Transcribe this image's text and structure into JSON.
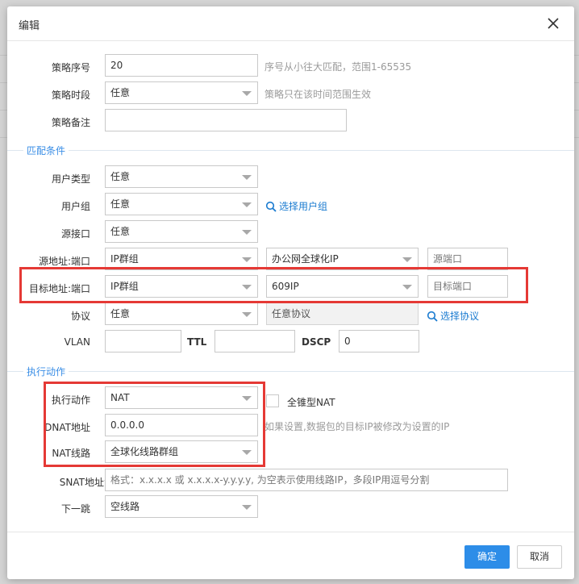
{
  "dialog": {
    "title": "编辑",
    "close_icon": "close-icon"
  },
  "policy": {
    "seq_label": "策略序号",
    "seq_value": "20",
    "seq_hint": "序号从小往大匹配，范围1-65535",
    "time_label": "策略时段",
    "time_value": "任意",
    "time_hint": "策略只在该时间范围生效",
    "note_label": "策略备注",
    "note_value": ""
  },
  "match": {
    "section_title": "匹配条件",
    "user_type_label": "用户类型",
    "user_type_value": "任意",
    "user_group_label": "用户组",
    "user_group_value": "任意",
    "select_user_group_link": "选择用户组",
    "src_iface_label": "源接口",
    "src_iface_value": "任意",
    "src_addr_label": "源地址:端口",
    "src_addr_type": "IP群组",
    "src_addr_group": "办公网全球化IP",
    "src_port_placeholder": "源端口",
    "dst_addr_label": "目标地址:端口",
    "dst_addr_type": "IP群组",
    "dst_addr_group": "609IP",
    "dst_port_placeholder": "目标端口",
    "protocol_label": "协议",
    "protocol_value": "任意",
    "protocol_detail": "任意协议",
    "select_protocol_link": "选择协议",
    "vlan_label": "VLAN",
    "vlan_value": "",
    "ttl_label": "TTL",
    "ttl_value": "",
    "dscp_label": "DSCP",
    "dscp_value": "0"
  },
  "action": {
    "section_title": "执行动作",
    "action_label": "执行动作",
    "action_value": "NAT",
    "full_cone_label": "全锥型NAT",
    "dnat_label": "DNAT地址",
    "dnat_value": "0.0.0.0",
    "dnat_hint": "如果设置,数据包的目标IP被修改为设置的IP",
    "nat_line_label": "NAT线路",
    "nat_line_value": "全球化线路群组",
    "snat_label": "SNAT地址池",
    "snat_placeholder": "格式：x.x.x.x 或 x.x.x.x-y.y.y.y, 为空表示使用线路IP，多段IP用逗号分割",
    "next_hop_label": "下一跳",
    "next_hop_value": "空线路"
  },
  "footer": {
    "confirm_label": "确定",
    "cancel_label": "取消"
  },
  "colors": {
    "primary": "#2d8de8",
    "link": "#1a7bd0",
    "section": "#3a8ee6",
    "highlight": "#e53935"
  }
}
